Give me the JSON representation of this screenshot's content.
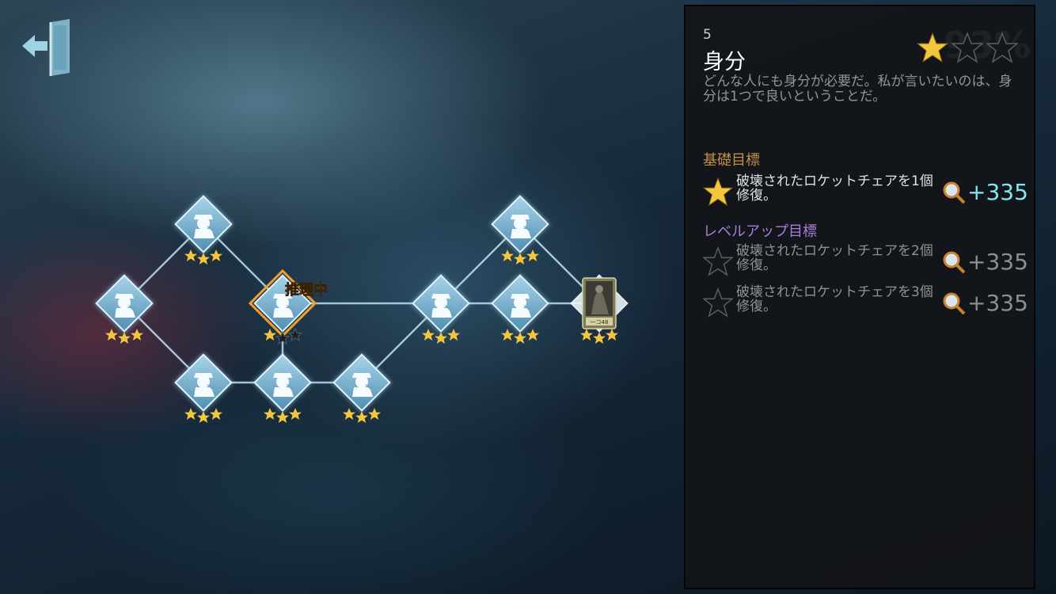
{
  "graph": {
    "active_label": "推理中",
    "card_text": "一コ48"
  },
  "nodes": [
    {
      "id": "n1",
      "stars": 3,
      "state": "done"
    },
    {
      "id": "n2",
      "stars": 3,
      "state": "done"
    },
    {
      "id": "n3",
      "stars": 1,
      "state": "active"
    },
    {
      "id": "n4",
      "stars": 3,
      "state": "done"
    },
    {
      "id": "n5",
      "stars": 3,
      "state": "done"
    },
    {
      "id": "n6",
      "stars": 3,
      "state": "done"
    },
    {
      "id": "n7",
      "stars": 3,
      "state": "done"
    },
    {
      "id": "n8",
      "stars": 3,
      "state": "done"
    },
    {
      "id": "n9",
      "stars": 3,
      "state": "done"
    },
    {
      "id": "n10",
      "stars": 3,
      "state": "card"
    }
  ],
  "panel": {
    "number": "5",
    "title": "身分",
    "rating": 1,
    "rating_max": 3,
    "description": "どんな人にも身分が必要だ。私が言いたいのは、身分は1つで良いということだ。",
    "basic_label": "基礎目標",
    "level_label": "レベルアップ目標",
    "goals": [
      {
        "text": "破壊されたロケットチェアを1個修復。",
        "reward": "+335",
        "achieved": true
      },
      {
        "text": "破壊されたロケットチェアを2個修復。",
        "reward": "+335",
        "achieved": false
      },
      {
        "text": "破壊されたロケットチェアを3個修復。",
        "reward": "+335",
        "achieved": false
      }
    ]
  },
  "colors": {
    "gold": "#f4c63d",
    "active_orange": "#f2a02a",
    "reward_cyan": "#7fe7f0",
    "node_blue": "#7fb7d6"
  }
}
